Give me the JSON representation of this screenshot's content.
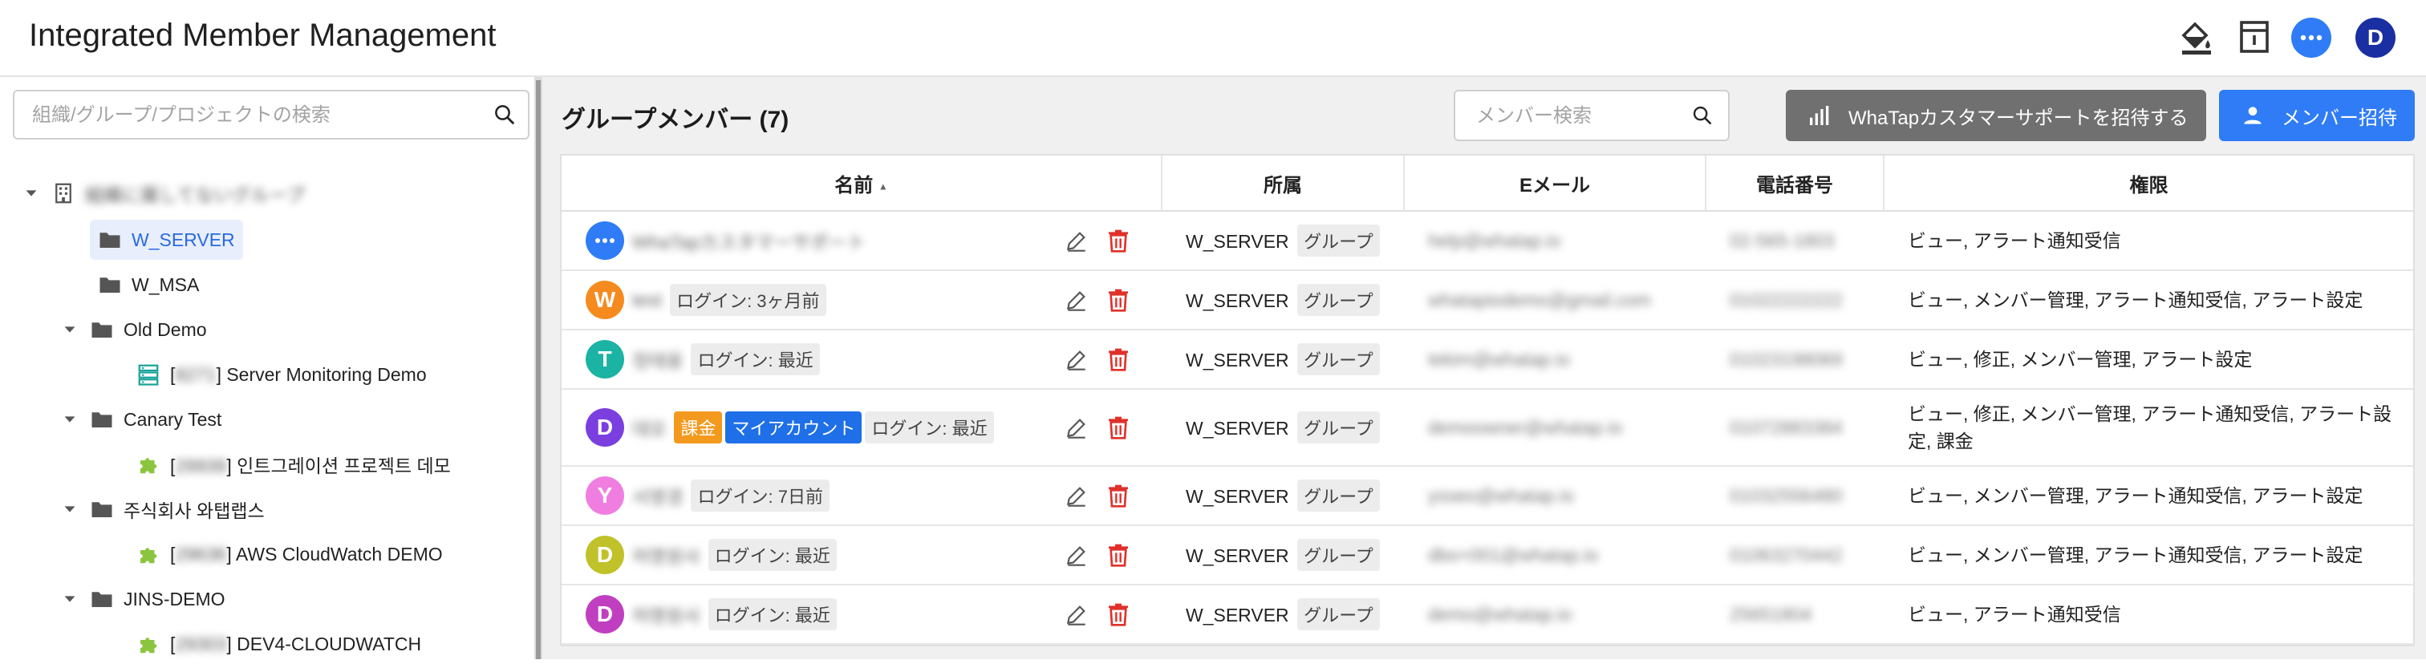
{
  "app": {
    "title": "Integrated Member Management"
  },
  "header": {
    "icons": [
      "paint-bucket-icon",
      "archive-icon",
      "chat-icon"
    ],
    "avatar_letter": "D",
    "colors": {
      "chat": "#2f7cf6",
      "avatar": "#1a2fa1"
    }
  },
  "sidebar": {
    "search_placeholder": "組織/グループ/プロジェクトの検索",
    "tree": [
      {
        "label": "組織に属してないグループ",
        "blurred": true,
        "icon": "building-icon",
        "expanded": true
      },
      {
        "label": "W_SERVER",
        "icon": "folder-icon",
        "selected": true
      },
      {
        "label": "W_MSA",
        "icon": "folder-icon"
      },
      {
        "label": "Old Demo",
        "icon": "folder-icon",
        "expanded": true
      },
      {
        "id": "8271",
        "label": "Server Monitoring Demo",
        "icon": "server-icon"
      },
      {
        "label": "Canary Test",
        "icon": "folder-icon",
        "expanded": true
      },
      {
        "id": "29939",
        "label": "인트그레이션 프로젝트 데모",
        "icon": "puzzle-icon"
      },
      {
        "label": "주식회사 와탭랩스",
        "icon": "folder-icon",
        "expanded": true
      },
      {
        "id": "29636",
        "label": "AWS CloudWatch DEMO",
        "icon": "puzzle-icon"
      },
      {
        "label": "JINS-DEMO",
        "icon": "folder-icon",
        "expanded": true
      },
      {
        "id": "29303",
        "label": "DEV4-CLOUDWATCH",
        "icon": "puzzle-icon"
      }
    ]
  },
  "main": {
    "title": "グループメンバー (7)",
    "search_placeholder": "メンバー検索",
    "invite_support_label": "WhaTapカスタマーサポートを招待する",
    "invite_label": "メンバー招待",
    "columns": [
      "名前",
      "所属",
      "Eメール",
      "電話番号",
      "権限"
    ],
    "sort_indicator": "▲",
    "members": [
      {
        "avatar": "•••",
        "avatar_color": "#2f7cf6",
        "name": "WhaTapカスタマーサポート",
        "badges": [],
        "login": "",
        "org": "W_SERVER",
        "org_type": "グループ",
        "email": "help@whatap.io",
        "phone": "02-565-1803",
        "perm": "ビュー, アラート通知受信"
      },
      {
        "avatar": "W",
        "avatar_color": "#f58a1f",
        "name": "test",
        "badges": [],
        "login": "ログイン: 3ヶ月前",
        "org": "W_SERVER",
        "org_type": "グループ",
        "email": "whatapiodemo@gmail.com",
        "phone": "01022222222",
        "perm": "ビュー, メンバー管理, アラート通知受信, アラート設定"
      },
      {
        "avatar": "T",
        "avatar_color": "#1bb3a4",
        "name": "정태웅",
        "badges": [],
        "login": "ログイン: 最近",
        "org": "W_SERVER",
        "org_type": "グループ",
        "email": "tekim@whatap.io",
        "phone": "01023198069",
        "perm": "ビュー, 修正, メンバー管理, アラート設定"
      },
      {
        "avatar": "D",
        "avatar_color": "#7b3fe0",
        "name": "데모",
        "badges": [
          "課金",
          "マイアカウント"
        ],
        "login": "ログイン: 最近",
        "org": "W_SERVER",
        "org_type": "グループ",
        "email": "demoowner@whatap.io",
        "phone": "01072883384",
        "perm": "ビュー, 修正, メンバー管理, アラート通知受信, アラート設定, 課金"
      },
      {
        "avatar": "Y",
        "avatar_color": "#f07ee0",
        "name": "서영경",
        "badges": [],
        "login": "ログイン: 7日前",
        "org": "W_SERVER",
        "org_type": "グループ",
        "email": "ysseo@whatap.io",
        "phone": "01032556480",
        "perm": "ビュー, メンバー管理, アラート通知受信, アラート設定"
      },
      {
        "avatar": "D",
        "avatar_color": "#c1c12a",
        "name": "허명원사",
        "badges": [],
        "login": "ログイン: 最近",
        "org": "W_SERVER",
        "org_type": "グループ",
        "email": "dbo+001@whatap.io",
        "phone": "01063270442",
        "perm": "ビュー, メンバー管理, アラート通知受信, アラート設定"
      },
      {
        "avatar": "D",
        "avatar_color": "#c03fc0",
        "name": "허명원사",
        "badges": [],
        "login": "ログイン: 最近",
        "org": "W_SERVER",
        "org_type": "グループ",
        "email": "demo@whatap.io",
        "phone": "25651804",
        "perm": "ビュー, アラート通知受信"
      }
    ]
  }
}
